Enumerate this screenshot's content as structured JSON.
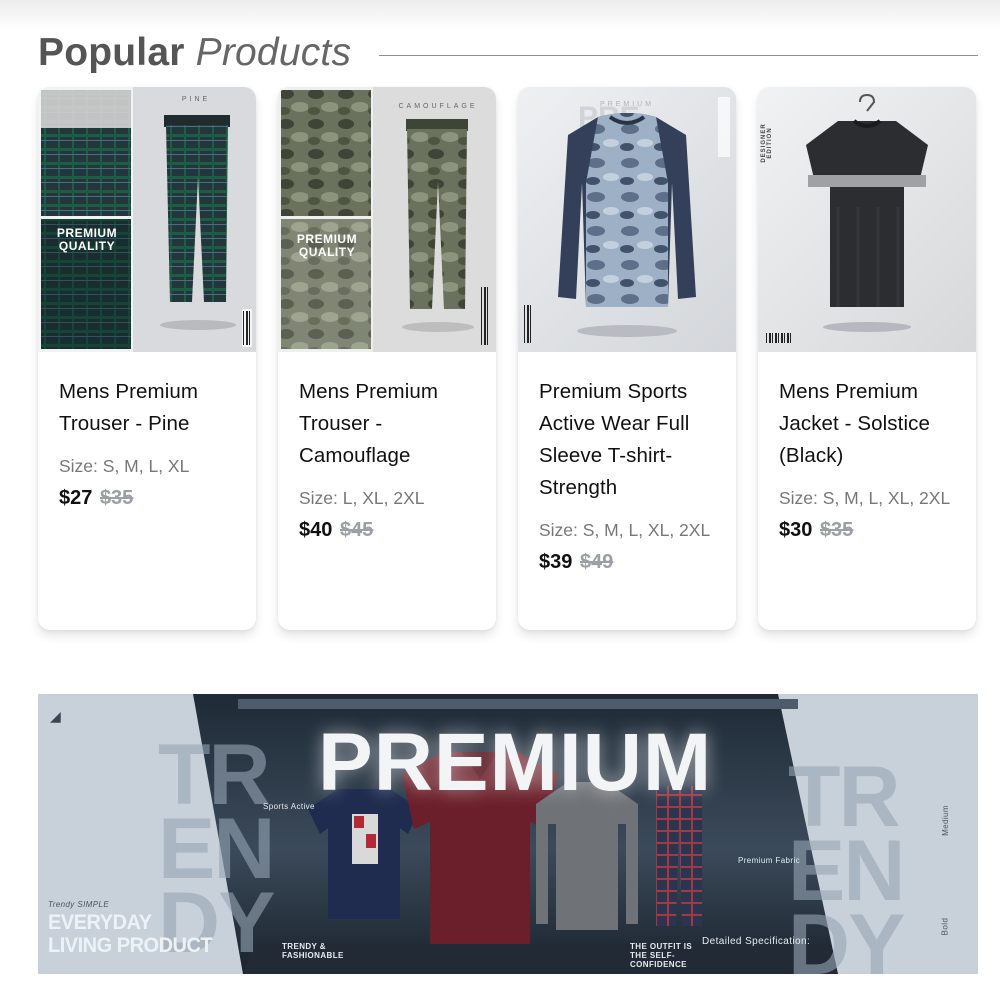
{
  "section": {
    "title_bold": "Popular",
    "title_light": "Products"
  },
  "products": [
    {
      "title": "Mens Premium Trouser - Pine",
      "size": "Size: S, M, L, XL",
      "price": "$27",
      "old_price": "$35",
      "image_label": "PINE",
      "image_badge": "PREMIUM QUALITY",
      "colors": {
        "main": "#2f4a45",
        "accent": "#123e2f"
      }
    },
    {
      "title": "Mens Premium Trouser - Camouflage",
      "size": "Size: L, XL, 2XL",
      "price": "$40",
      "old_price": "$45",
      "image_label": "CAMOUFLAGE",
      "image_badge": "PREMIUM QUALITY",
      "colors": {
        "main": "#59634e",
        "accent": "#7d8670"
      }
    },
    {
      "title": "Premium Sports Active Wear Full Sleeve T-shirt- Strength",
      "size": "Size: S, M, L, XL, 2XL",
      "price": "$39",
      "old_price": "$49",
      "image_label": "PREMIUM",
      "colors": {
        "main": "#8c9fb6",
        "accent": "#2f3a52"
      }
    },
    {
      "title": "Mens Premium Jacket - Solstice (Black)",
      "size": "Size: S, M, L, XL, 2XL",
      "price": "$30",
      "old_price": "$35",
      "image_label": "DESIGNER EDITION",
      "colors": {
        "main": "#2c2d31",
        "accent": "#9fa1a5"
      }
    }
  ],
  "banner": {
    "headline": "PREMIUM",
    "ghost_left": [
      "TR",
      "EN",
      "DY"
    ],
    "ghost_right": [
      "TR",
      "EN",
      "DY"
    ],
    "bottom_left": [
      "EVERYDAY",
      "LIVING PRODUCT"
    ],
    "tagline_left": "Trendy SIMPLE",
    "caption_trendy": "TRENDY & FASHIONABLE",
    "caption_outfit": "THE OUTFIT IS THE SELF-CONFIDENCE",
    "spec_title": "Detailed Specification:",
    "tag_sports": "Sports Active",
    "tag_premium": "Premium Fabric",
    "side_medium": "Medium",
    "side_bold": "Bold",
    "colors": {
      "bg": "#c8d1da",
      "dark": "#2c3a48",
      "polo": "#6b1f2a",
      "tee": "#1f2c4f",
      "shirt": "#6f7378"
    }
  }
}
